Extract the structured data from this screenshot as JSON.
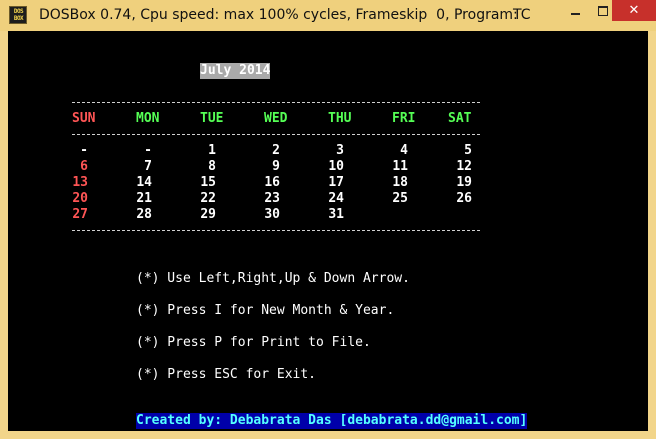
{
  "window": {
    "icon_lines": [
      "DOS",
      "BOX"
    ],
    "title": "DOSBox 0.74, Cpu speed: max 100% cycles, Frameskip  0, Program:",
    "program": "TC",
    "controls": {
      "minimize": "–",
      "maximize": "□",
      "close": "✕"
    }
  },
  "calendar": {
    "month_title": "July 2014",
    "days": [
      "SUN",
      "MON",
      "TUE",
      "WED",
      "THU",
      "FRI",
      "SAT"
    ],
    "weeks": [
      [
        "",
        "-",
        "-",
        "1",
        "2",
        "3",
        "4",
        "5"
      ],
      [
        "6",
        "7",
        "8",
        "9",
        "10",
        "11",
        "12"
      ],
      [
        "13",
        "14",
        "15",
        "16",
        "17",
        "18",
        "19"
      ],
      [
        "20",
        "21",
        "22",
        "23",
        "24",
        "25",
        "26"
      ],
      [
        "27",
        "28",
        "29",
        "30",
        "31",
        "",
        ""
      ]
    ]
  },
  "instructions": [
    "(*) Use Left,Right,Up & Down Arrow.",
    "(*) Press I for New Month & Year.",
    "(*) Press P for Print to File.",
    "(*) Press ESC for Exit."
  ],
  "credit": "Created by: Debabrata Das [debabrata.dd@gmail.com]",
  "colors": {
    "sunday": "#ff5555",
    "weekday_header": "#55ff55",
    "credit_bg": "#0000aa",
    "credit_fg": "#55ffff",
    "title_highlight": "#aaaaaa"
  }
}
